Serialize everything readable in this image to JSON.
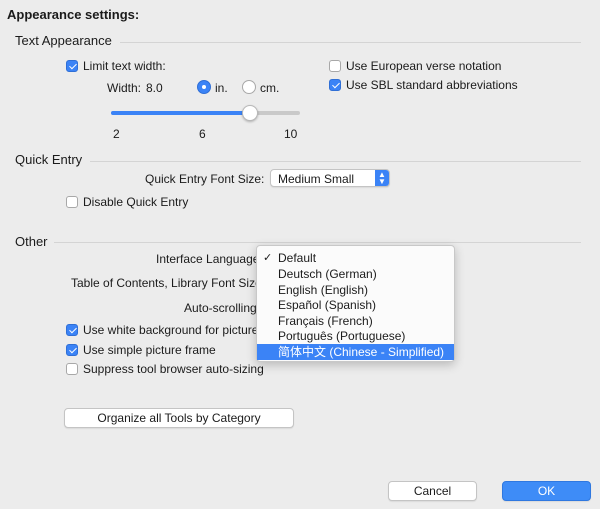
{
  "header": {
    "title": "Appearance settings:"
  },
  "text_appearance": {
    "section": "Text Appearance",
    "limit_width": {
      "label": "Limit text width:",
      "checked": true
    },
    "width_label": "Width:",
    "width_value": "8.0",
    "units": [
      {
        "label": "in.",
        "selected": true
      },
      {
        "label": "cm.",
        "selected": false
      }
    ],
    "slider": {
      "value": 8.0,
      "min": 2,
      "max": 10,
      "ticks": [
        "2",
        "6",
        "10"
      ]
    },
    "european_verse": {
      "label": "Use European verse notation",
      "checked": false
    },
    "sbl_abbrev": {
      "label": "Use SBL standard abbreviations",
      "checked": true
    }
  },
  "quick_entry": {
    "section": "Quick Entry",
    "font_size_label": "Quick Entry Font Size:",
    "font_size_value": "Medium Small",
    "disable": {
      "label": "Disable Quick Entry",
      "checked": false
    }
  },
  "other": {
    "section": "Other",
    "interface_language_label": "Interface Language:",
    "toc_font_label": "Table of Contents, Library Font Size:",
    "auto_scroll_label": "Auto-scrolling",
    "white_bg": {
      "label": "Use white background for pictures",
      "checked": true
    },
    "simple_frame": {
      "label": "Use simple picture frame",
      "checked": true
    },
    "suppress_autosize": {
      "label": "Suppress tool browser auto-sizing",
      "checked": false
    },
    "organize_button": "Organize all Tools by Category"
  },
  "language_menu": {
    "checkmark": "✓",
    "items": [
      {
        "label": "Default",
        "checked": true,
        "highlighted": false
      },
      {
        "label": "Deutsch (German)",
        "checked": false,
        "highlighted": false
      },
      {
        "label": "English (English)",
        "checked": false,
        "highlighted": false
      },
      {
        "label": "Español (Spanish)",
        "checked": false,
        "highlighted": false
      },
      {
        "label": "Français (French)",
        "checked": false,
        "highlighted": false
      },
      {
        "label": "Português (Portuguese)",
        "checked": false,
        "highlighted": false
      },
      {
        "label": "简体中文 (Chinese - Simplified)",
        "checked": false,
        "highlighted": true
      }
    ]
  },
  "footer": {
    "cancel": "Cancel",
    "ok": "OK"
  },
  "colors": {
    "accent": "#3b83f6",
    "background": "#ececec"
  }
}
